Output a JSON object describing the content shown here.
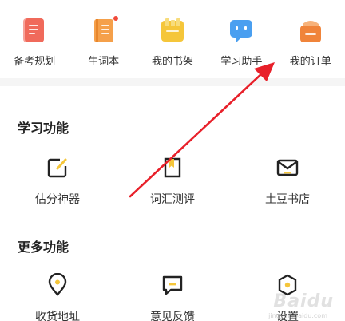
{
  "top_nav": [
    {
      "label": "备考规划",
      "icon": "planner-icon",
      "color": "#f06a5b"
    },
    {
      "label": "生词本",
      "icon": "vocabulary-book-icon",
      "color": "#f5a04a",
      "badge": true
    },
    {
      "label": "我的书架",
      "icon": "bookshelf-icon",
      "color": "#f5c63a"
    },
    {
      "label": "学习助手",
      "icon": "study-assistant-icon",
      "color": "#4a9ff0"
    },
    {
      "label": "我的订单",
      "icon": "orders-icon",
      "color": "#f0843a"
    }
  ],
  "study_section": {
    "title": "学习功能",
    "items": [
      {
        "label": "估分神器",
        "icon": "edit-icon"
      },
      {
        "label": "词汇测评",
        "icon": "bookmark-icon"
      },
      {
        "label": "土豆书店",
        "icon": "mail-icon"
      }
    ]
  },
  "more_section": {
    "title": "更多功能",
    "items": [
      {
        "label": "收货地址",
        "icon": "location-pin-icon"
      },
      {
        "label": "意见反馈",
        "icon": "feedback-icon"
      },
      {
        "label": "设置",
        "icon": "settings-icon"
      }
    ]
  },
  "watermark": {
    "text": "Baidu",
    "sub": "jingyan.baidu.com"
  },
  "colors": {
    "accent": "#f5c63a",
    "arrow": "#e8202a"
  }
}
